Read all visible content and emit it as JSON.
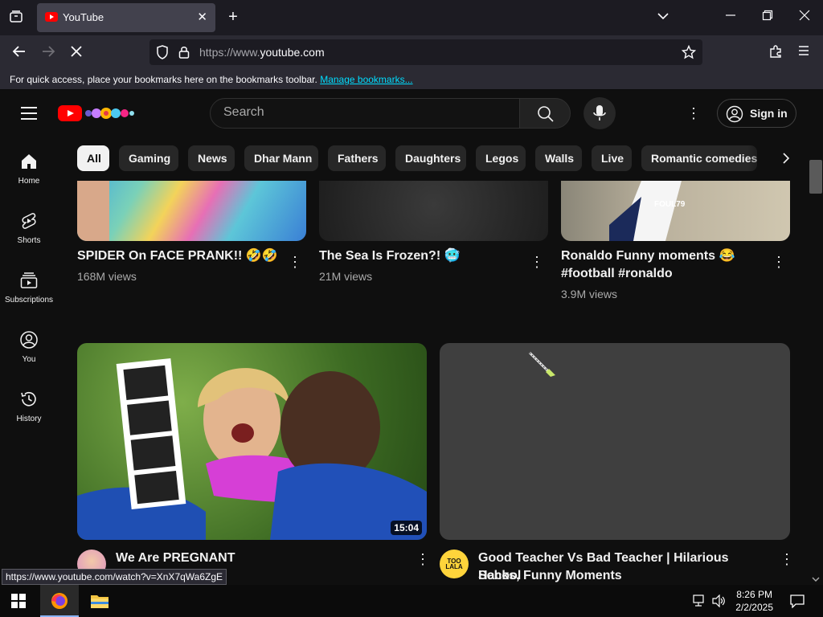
{
  "browser": {
    "tab_title": "YouTube",
    "url_prefix": "https://www.",
    "url_domain": "youtube.com",
    "bookmarks_text": "For quick access, place your bookmarks here on the bookmarks toolbar.",
    "bookmarks_link": "Manage bookmarks...",
    "status_url": "https://www.youtube.com/watch?v=XnX7qWa6ZgE"
  },
  "header": {
    "search_placeholder": "Search",
    "signin_label": "Sign in"
  },
  "sidebar": {
    "items": [
      {
        "label": "Home",
        "icon": "home-icon"
      },
      {
        "label": "Shorts",
        "icon": "shorts-icon"
      },
      {
        "label": "Subscriptions",
        "icon": "subscriptions-icon"
      },
      {
        "label": "You",
        "icon": "you-icon"
      },
      {
        "label": "History",
        "icon": "history-icon"
      }
    ]
  },
  "chips": [
    "All",
    "Gaming",
    "News",
    "Dhar Mann",
    "Fathers",
    "Daughters",
    "Legos",
    "Walls",
    "Live",
    "Romantic comedies"
  ],
  "row1": [
    {
      "title": "SPIDER On FACE PRANK!! 🤣🤣",
      "views": "168M views"
    },
    {
      "title": "The Sea Is Frozen?! 🥶",
      "views": "21M views"
    },
    {
      "title_line1": "Ronaldo Funny moments 😂",
      "title_line2": "#football #ronaldo",
      "views": "3.9M views",
      "thumb_text": "FOUL79"
    }
  ],
  "row2": [
    {
      "title": "We Are PREGNANT",
      "duration": "15:04"
    },
    {
      "title_line1": "Good Teacher Vs Bad Teacher | Hilarious School",
      "title_line2": "Hacks, Funny Moments",
      "avatar_text": "TOO LALA"
    }
  ],
  "taskbar": {
    "time": "8:26 PM",
    "date": "2/2/2025"
  },
  "colors": {
    "background": "#0f0f0f",
    "chip_bg": "#272727",
    "chip_active_bg": "#f1f1f1",
    "youtube_red": "#ff0000",
    "link": "#00ddff"
  }
}
